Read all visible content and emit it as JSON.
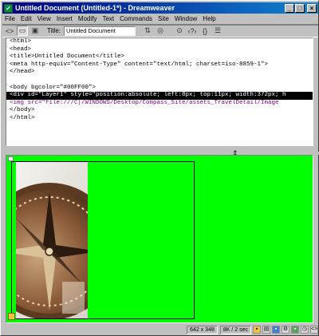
{
  "window": {
    "title": "Untitled Document (Untitled-1*) - Dreamweaver",
    "app_icon": "dreamweaver-icon",
    "minimize_glyph": "_",
    "maximize_glyph": "□",
    "close_glyph": "×"
  },
  "menu": [
    "File",
    "Edit",
    "View",
    "Insert",
    "Modify",
    "Text",
    "Commands",
    "Site",
    "Window",
    "Help"
  ],
  "toolbar": {
    "title_label": "Title:",
    "title_value": "Untitled Document"
  },
  "code": {
    "lines": [
      "<html>",
      "<head>",
      "<title>Untitled Document</title>",
      "<meta http-equiv=\"Content-Type\" content=\"text/html; charset=iso-8859-1\">",
      "</head>",
      "",
      "<body bgcolor=\"#00FF00\">",
      "<div id=\"Layer1\" style=\"position:absolute; left:8px; top:11px; width:372px; h",
      "<img src=\"file:///C|/WINDOWS/Desktop/Compass_Site/assets_TravelDetail/Image",
      "</body>",
      "</html>"
    ],
    "highlighted_line": 7,
    "purple_line": 8
  },
  "design": {
    "background_color": "#00ff00",
    "image_alt": "compass photo"
  },
  "status": {
    "size": "642 x 348",
    "download": "8K / 2 sec"
  }
}
